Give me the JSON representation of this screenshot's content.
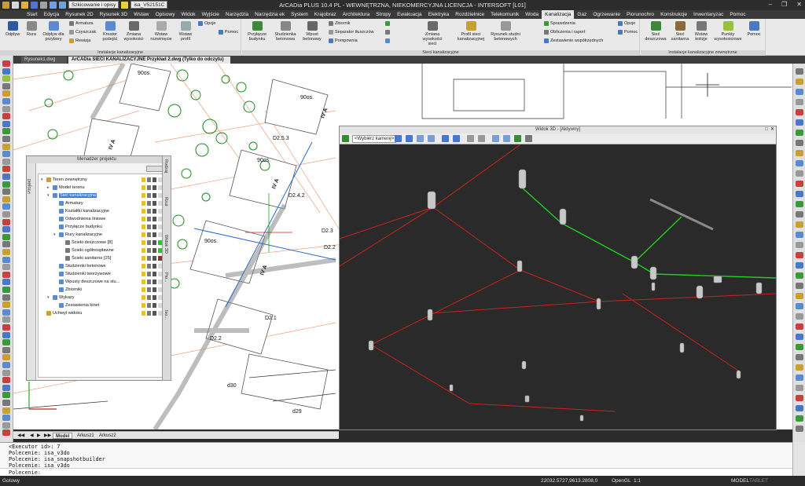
{
  "titlebar": {
    "quick_combo": "Szkicowanie i opisy",
    "file_combo": "isa_V52151C",
    "title": "ArCADia PLUS 10.4 PL - WEWNĘTRZNA, NIEKOMERCYJNA LICENCJA - INTERSOFT [L01]"
  },
  "menu_tabs": [
    "Start",
    "Edycja",
    "Rysunek 2D",
    "Rysunek 3D",
    "Wstaw",
    "Opisowy",
    "Widok",
    "Wyjście",
    "Narzędzia",
    "Narzędzia ek",
    "System",
    "Krajobraz",
    "Architektura",
    "Stropy",
    "Ewakuacja",
    "Elektryka",
    "Rozdzielnice",
    "Telekomunik",
    "Woda",
    "Kanalizacja",
    "Gaz",
    "Ogrzewanie",
    "Piorunochro",
    "Konstrukcje",
    "Inwentaryzac",
    "Pomoc"
  ],
  "active_tab": "Kanalizacja",
  "ribbon": {
    "groups": [
      "Instalacje kanalizacyjne",
      "Sieci kanalizacyjne",
      "Instalacje kanalizacyjne zewnętrzne"
    ],
    "buttons": {
      "odplyw": "Odpływ",
      "rura": "Rura",
      "odplyw_przyb": "Odpływ dla przybory",
      "armatura": "Armatura",
      "czyszczak": "Czyszczak",
      "rewizja": "Rewizja",
      "kreator": "Kreator podejść",
      "zmiana_wys": "Zmiana wysokości",
      "wstaw_rozw": "Wstaw rozwinięcie",
      "wstaw_profil": "Wstaw profil",
      "opcje": "Opcje",
      "pomoc": "Pomoc",
      "przylacze": "Przyłącze budynku",
      "studzienka": "Studzienka betonowa",
      "wpust": "Wpust betonowy",
      "zbiornik": "Zbiornik",
      "separator": "Separator tłuszczów",
      "pompownia": "Pompownia",
      "zmiana_wys2": "Zmiana wysokości sieci",
      "profil_sieci": "Profil sieci kanalizacyjnej",
      "rysunek_studni": "Rysunek studni betonowych",
      "sprawdzenia": "Sprawdzenia",
      "obliczenia": "Obliczenia i raport",
      "zestawienie": "Zestawienie współrzędnych",
      "opcje2": "Opcje",
      "pomoc2": "Pomoc",
      "siec_deszcz": "Sieć deszczowa",
      "siec_sanit": "Sieć sanitarna",
      "wstaw_kolizje": "Wstaw kolizje",
      "punkty_wys": "Punkty wysokościowe",
      "pomoc3": "Pomoc"
    }
  },
  "doc_tabs": [
    "Rysunek1.dwg",
    "ArCADia SIECI KANALIZACYJNE Przykład 2.dwg (Tylko do odczytu)"
  ],
  "project_manager": {
    "title": "Menadżer projektu",
    "side_tab": "Projekt",
    "items": [
      {
        "label": "Teren zewnętrzny",
        "level": 0,
        "exp": "▾"
      },
      {
        "label": "Model terenu",
        "level": 1,
        "exp": "▸"
      },
      {
        "label": "Sieć kanalizacyjna",
        "level": 1,
        "exp": "▾",
        "selected": true
      },
      {
        "label": "Armatury",
        "level": 2,
        "exp": ""
      },
      {
        "label": "Kształtki kanalizacyjne",
        "level": 2,
        "exp": ""
      },
      {
        "label": "Odwodnienia liniowe",
        "level": 2,
        "exp": ""
      },
      {
        "label": "Przyłącze budynku",
        "level": 2,
        "exp": ""
      },
      {
        "label": "Rury kanalizacyjne",
        "level": 2,
        "exp": "▾"
      },
      {
        "label": "Ścieki deszczowe [8]",
        "level": 3,
        "exp": ""
      },
      {
        "label": "Ścieki ogólnospławne",
        "level": 3,
        "exp": ""
      },
      {
        "label": "Ścieki sanitarne [25]",
        "level": 3,
        "exp": ""
      },
      {
        "label": "Studzienki betonowe",
        "level": 2,
        "exp": ""
      },
      {
        "label": "Studzienki tworzywowe",
        "level": 2,
        "exp": ""
      },
      {
        "label": "Wpusty deszczowe na stu...",
        "level": 2,
        "exp": ""
      },
      {
        "label": "Zbiorniki",
        "level": 2,
        "exp": ""
      },
      {
        "label": "Wykazy",
        "level": 1,
        "exp": "▾"
      },
      {
        "label": "Zestawienia kinet",
        "level": 2,
        "exp": ""
      },
      {
        "label": "Uchwyt widoku",
        "level": 0,
        "exp": ""
      }
    ],
    "right_tabs": [
      "Rodzaj",
      "Rzut",
      "Widok 3D",
      "Pio...",
      "Iso..."
    ]
  },
  "view3d": {
    "title": "Widok 3D - [Aktywny]",
    "camera": "<Wybierz kamerę>"
  },
  "map_labels": [
    "90os.",
    "IV A",
    "IV A",
    "IV A",
    "IV A",
    "D2.5.3",
    "D2.4.2",
    "D2.3",
    "D2.2",
    "D2.1",
    "D2.2",
    "90os.",
    "90os.",
    "d30",
    "d29",
    "90os."
  ],
  "layout_tabs": [
    "Model",
    "Arkusz1",
    "Arkusz2"
  ],
  "command_lines": [
    "<Executor id>: 7",
    "Polecenie: isa_v3do",
    "Polecenie: isa_snapshotbuilder",
    "Polecenie: isa_v3do"
  ],
  "command_prompt": "Polecenie:",
  "status": {
    "ready": "Gotowy",
    "coords": "22032.5727,9613.2808,0",
    "renderer": "OpenGL",
    "scale": "1:1",
    "mode": "MODEL",
    "tablet": "TABLET"
  },
  "colors": {
    "green_pipe": "#22cc22",
    "red_pipe": "#cc2222",
    "selection": "#3b7bd1",
    "ribbon": "#e9e9e9"
  }
}
